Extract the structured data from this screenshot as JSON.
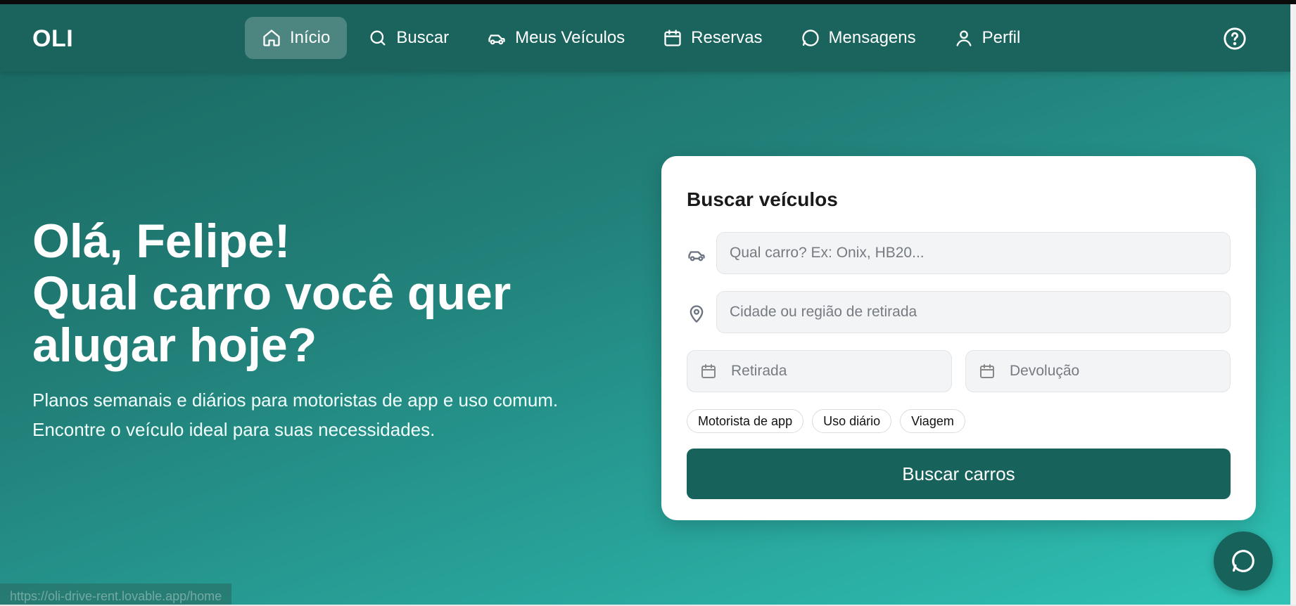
{
  "header": {
    "logo": "OLI",
    "nav": [
      {
        "label": "Início",
        "icon": "home-icon",
        "active": true
      },
      {
        "label": "Buscar",
        "icon": "search-icon"
      },
      {
        "label": "Meus Veículos",
        "icon": "car-icon"
      },
      {
        "label": "Reservas",
        "icon": "calendar-icon"
      },
      {
        "label": "Mensagens",
        "icon": "chat-icon"
      },
      {
        "label": "Perfil",
        "icon": "user-icon"
      }
    ],
    "help_icon": "help-icon"
  },
  "hero": {
    "title_line1": "Olá, Felipe!",
    "title_line2": "Qual carro você quer",
    "title_line3": "alugar hoje?",
    "subtitle_line1": "Planos semanais e diários para motoristas de app e uso comum.",
    "subtitle_line2": "Encontre o veículo ideal para suas necessidades."
  },
  "search": {
    "title": "Buscar veículos",
    "car_placeholder": "Qual carro? Ex: Onix, HB20...",
    "location_placeholder": "Cidade ou região de retirada",
    "pickup_placeholder": "Retirada",
    "return_placeholder": "Devolução",
    "chips": [
      "Motorista de app",
      "Uso diário",
      "Viagem"
    ],
    "submit_label": "Buscar carros"
  },
  "status_url": "https://oli-drive-rent.lovable.app/home",
  "colors": {
    "primary": "#17625b",
    "header_bg": "#1b645e",
    "gradient_start": "#19665f",
    "gradient_end": "#2fc3b6"
  }
}
